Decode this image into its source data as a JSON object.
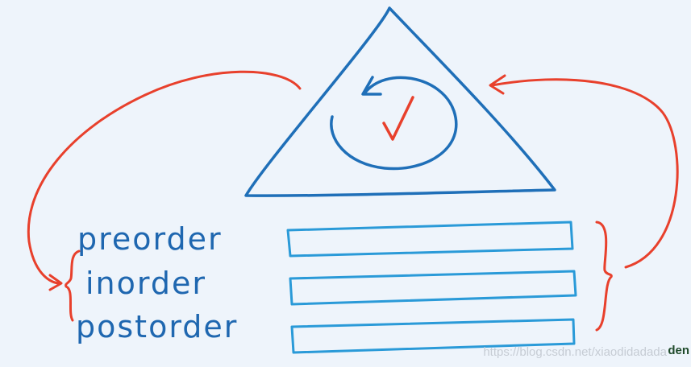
{
  "labels": {
    "preorder": "preorder",
    "inorder": "inorder",
    "postorder": "postorder"
  },
  "watermark": "https://blog.csdn.net/xiaodidadada",
  "brand": "den",
  "colors": {
    "background": "#eef4fb",
    "blue_ink": "#1f67b0",
    "light_blue_ink": "#2a9ad8",
    "red_ink": "#e8402c"
  }
}
